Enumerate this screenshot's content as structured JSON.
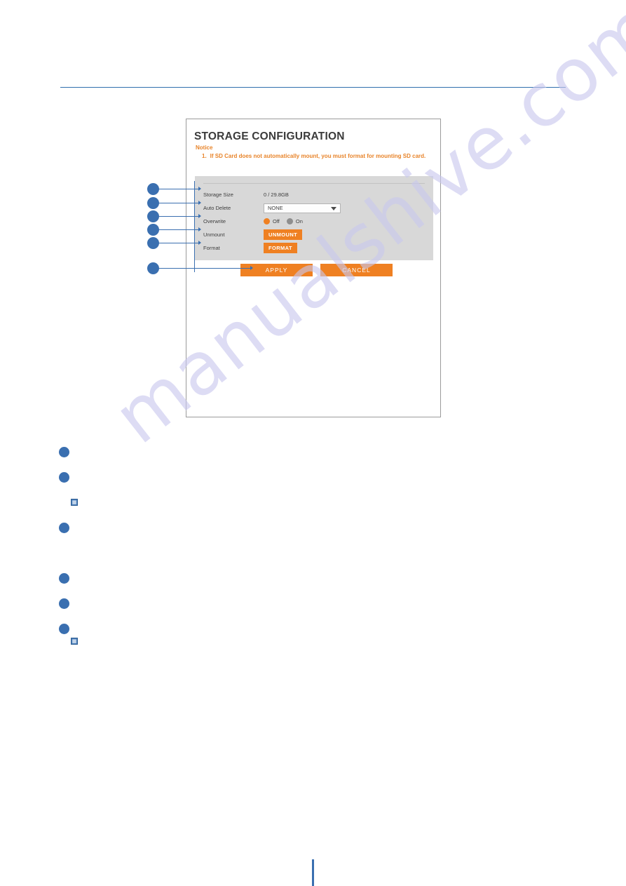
{
  "page": {
    "background_color": "#ffffff",
    "accent_blue": "#3a6fb0",
    "accent_orange": "#ef8022",
    "watermark": "manualshive.com"
  },
  "panel": {
    "title": "STORAGE CONFIGURATION",
    "notice_label": "Notice",
    "notice_items": [
      {
        "number": "1.",
        "text": "If SD Card does not automatically mount, you must format for mounting SD card."
      }
    ],
    "rows": [
      {
        "label": "Storage Size",
        "type": "text",
        "value": "0 / 29.8GB"
      },
      {
        "label": "Auto Delete",
        "type": "select",
        "value": "NONE"
      },
      {
        "label": "Overwrite",
        "type": "radio",
        "options": [
          {
            "label": "Off",
            "selected": true
          },
          {
            "label": "On",
            "selected": false
          }
        ]
      },
      {
        "label": "Unmount",
        "type": "button",
        "value": "UNMOUNT"
      },
      {
        "label": "Format",
        "type": "button",
        "value": "FORMAT"
      }
    ],
    "actions": [
      {
        "label": "APPLY"
      },
      {
        "label": "CANCEL"
      }
    ]
  },
  "callouts": {
    "markers": [
      "",
      "",
      "",
      "",
      "",
      ""
    ]
  },
  "lower_section": {
    "bullets": [
      "",
      "",
      "",
      "",
      ""
    ],
    "note_icons": [
      "note-icon",
      "note-icon"
    ]
  }
}
